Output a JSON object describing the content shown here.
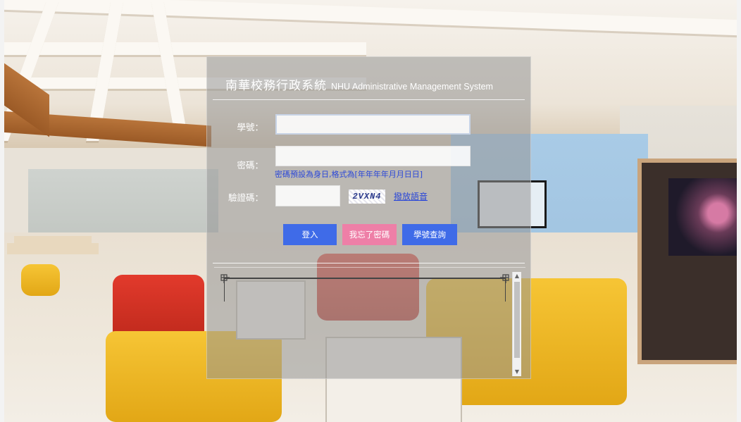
{
  "header": {
    "title_cn": "南華校務行政系統",
    "title_en": "NHU Administrative Management System"
  },
  "form": {
    "student_id_label": "學號：",
    "student_id_value": "",
    "password_label": "密碼：",
    "password_value": "",
    "password_hint": "密碼預設為身日,格式為[年年年年月月日日]",
    "captcha_label": "驗證碼：",
    "captcha_value": "",
    "captcha_image_text": "2VXN4",
    "audio_link": "撥放語音"
  },
  "buttons": {
    "login": "登入",
    "forgot_password": "我忘了密碼",
    "student_id_query": "學號查詢"
  },
  "notice_panel": {
    "scroll_up_icon": "triangle-up",
    "scroll_down_icon": "triangle-down"
  },
  "colors": {
    "primary_button": "#3f6be8",
    "secondary_button": "#ee7fa7",
    "link": "#2a47d8"
  }
}
